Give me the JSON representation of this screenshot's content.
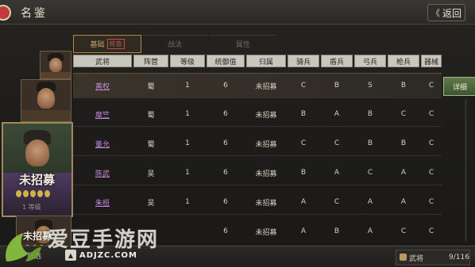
{
  "header": {
    "title": "名鉴",
    "return_label": "返回"
  },
  "tabs": [
    {
      "label": "基础",
      "active": true,
      "badge": "核查"
    },
    {
      "label": "战法",
      "active": false
    },
    {
      "label": "属性",
      "active": false
    }
  ],
  "table": {
    "columns": [
      "武将",
      "阵营",
      "等级",
      "统御值",
      "归属",
      "骑兵",
      "盾兵",
      "弓兵",
      "枪兵",
      "器械"
    ],
    "rows": [
      {
        "name": "黄权",
        "faction": "蜀",
        "level": "1",
        "command": "6",
        "status": "未招募",
        "cavalry": "C",
        "shield": "B",
        "archer": "S",
        "spear": "B",
        "siege": "C",
        "selected": true
      },
      {
        "name": "糜竺",
        "faction": "蜀",
        "level": "1",
        "command": "6",
        "status": "未招募",
        "cavalry": "B",
        "shield": "A",
        "archer": "B",
        "spear": "C",
        "siege": "C"
      },
      {
        "name": "董允",
        "faction": "蜀",
        "level": "1",
        "command": "6",
        "status": "未招募",
        "cavalry": "C",
        "shield": "C",
        "archer": "B",
        "spear": "B",
        "siege": "C"
      },
      {
        "name": "陈武",
        "faction": "吴",
        "level": "1",
        "command": "6",
        "status": "未招募",
        "cavalry": "B",
        "shield": "A",
        "archer": "C",
        "spear": "A",
        "siege": "C"
      },
      {
        "name": "朱桓",
        "faction": "吴",
        "level": "1",
        "command": "6",
        "status": "未招募",
        "cavalry": "A",
        "shield": "C",
        "archer": "A",
        "spear": "A",
        "siege": "C"
      },
      {
        "name": "",
        "faction": "",
        "level": "",
        "command": "6",
        "status": "未招募",
        "cavalry": "A",
        "shield": "B",
        "archer": "A",
        "spear": "C",
        "siege": "C"
      }
    ]
  },
  "detail_label": "详细",
  "portraits": {
    "recruit_tag": "未招募",
    "level_text": "1 等级"
  },
  "bottom": {
    "filter_label": "筛选",
    "up_label": "▲",
    "generals_label": "武将",
    "count": "9/116"
  },
  "watermark": {
    "name": "爱豆手游网",
    "url": "ADJZC.COM"
  }
}
